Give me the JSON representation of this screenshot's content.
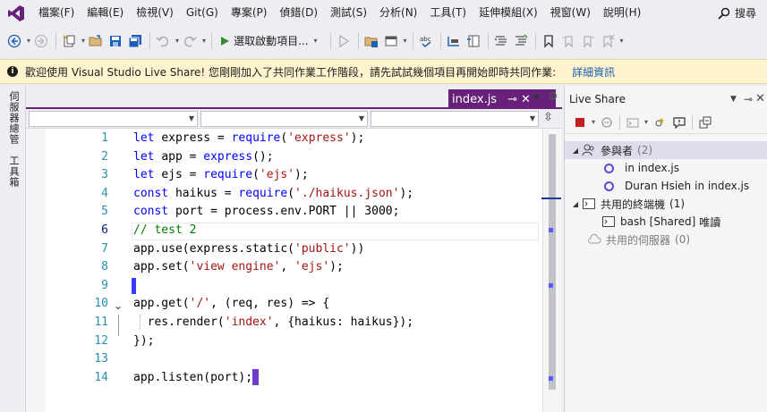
{
  "menu": {
    "items": [
      "檔案(F)",
      "編輯(E)",
      "檢視(V)",
      "Git(G)",
      "專案(P)",
      "偵錯(D)",
      "測試(S)",
      "分析(N)",
      "工具(T)",
      "延伸模組(X)",
      "視窗(W)",
      "說明(H)"
    ],
    "search_label": "搜尋"
  },
  "toolbar": {
    "start_label": "選取啟動項目..."
  },
  "infobar": {
    "message": "歡迎使用 Visual Studio Live Share! 您剛剛加入了共同作業工作階段，請先試試幾個項目再開始即時共同作業:",
    "link": "詳細資訊"
  },
  "siderail": {
    "items": [
      "伺服器總管",
      "工具箱"
    ]
  },
  "editor": {
    "tab_name": "index.js",
    "active_line": 6,
    "lines": [
      {
        "n": "1",
        "parts": [
          [
            "kw",
            "let "
          ],
          [
            "pl",
            "express = "
          ],
          [
            "kw",
            "require"
          ],
          [
            "pl",
            "("
          ],
          [
            "str",
            "'express'"
          ],
          [
            "pl",
            ");"
          ]
        ]
      },
      {
        "n": "2",
        "parts": [
          [
            "kw",
            "let "
          ],
          [
            "pl",
            "app = "
          ],
          [
            "kw",
            "express"
          ],
          [
            "pl",
            "();"
          ]
        ]
      },
      {
        "n": "3",
        "parts": [
          [
            "kw",
            "let "
          ],
          [
            "pl",
            "ejs = "
          ],
          [
            "kw",
            "require"
          ],
          [
            "pl",
            "("
          ],
          [
            "str",
            "'ejs'"
          ],
          [
            "pl",
            ");"
          ]
        ]
      },
      {
        "n": "4",
        "parts": [
          [
            "kw",
            "const "
          ],
          [
            "pl",
            "haikus = "
          ],
          [
            "kw",
            "require"
          ],
          [
            "pl",
            "("
          ],
          [
            "str",
            "'./haikus.json'"
          ],
          [
            "pl",
            ");"
          ]
        ]
      },
      {
        "n": "5",
        "parts": [
          [
            "kw",
            "const "
          ],
          [
            "pl",
            "port = process.env.PORT || 3000;"
          ]
        ]
      },
      {
        "n": "6",
        "parts": [
          [
            "cm",
            "// test 2"
          ]
        ]
      },
      {
        "n": "7",
        "parts": [
          [
            "pl",
            "app.use(express.static("
          ],
          [
            "str",
            "'public'"
          ],
          [
            "pl",
            "))"
          ]
        ]
      },
      {
        "n": "8",
        "parts": [
          [
            "pl",
            "app.set("
          ],
          [
            "str",
            "'view engine'"
          ],
          [
            "pl",
            ", "
          ],
          [
            "str",
            "'ejs'"
          ],
          [
            "pl",
            ");"
          ]
        ]
      },
      {
        "n": "9",
        "parts": []
      },
      {
        "n": "10",
        "parts": [
          [
            "pl",
            "app.get("
          ],
          [
            "str",
            "'/'"
          ],
          [
            "pl",
            ", (req, res) => {"
          ]
        ]
      },
      {
        "n": "11",
        "parts": [
          [
            "pl",
            "  res.render("
          ],
          [
            "str",
            "'index'"
          ],
          [
            "pl",
            ", {haikus: haikus});"
          ]
        ]
      },
      {
        "n": "12",
        "parts": [
          [
            "pl",
            "});"
          ]
        ]
      },
      {
        "n": "13",
        "parts": []
      },
      {
        "n": "14",
        "parts": [
          [
            "pl",
            "app.listen(port);"
          ]
        ]
      }
    ]
  },
  "liveshare": {
    "title": "Live Share",
    "participants_label": "參與者",
    "participants_count": "(2)",
    "participant1_file": "in index.js",
    "participant2_name": "Duran Hsieh",
    "participant2_file": "in index.js",
    "terminals_label": "共用的終端機",
    "terminals_count": "(1)",
    "terminal_name": "bash [Shared]",
    "terminal_mode": "唯讀",
    "servers_label": "共用的伺服器",
    "servers_count": "(0)"
  },
  "colors": {
    "accent": "#68217a",
    "keyword": "#0000ff",
    "string": "#a31515",
    "comment": "#008000",
    "line_number": "#2b91af",
    "infobar": "#fff4ce"
  }
}
